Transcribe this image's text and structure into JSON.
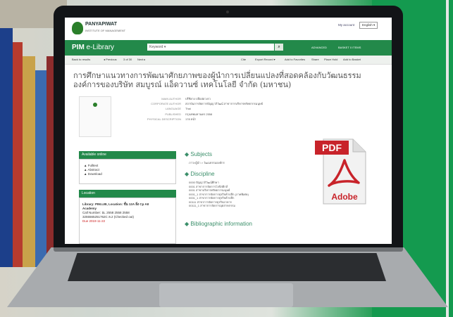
{
  "header": {
    "brand": "PANYAPIWAT",
    "brand_sub": "INSTITUTE OF MANAGEMENT",
    "myaccount": "My account",
    "language": "English ▾"
  },
  "nav": {
    "title_bold": "PIM",
    "title_rest": " e-Library",
    "keyword": "Keyword  ▾",
    "advanced": "ADVANCED",
    "basket": "BASKET 0 ITEMS"
  },
  "toolbar": {
    "back": "Back to results",
    "previous": "◂ Previous",
    "count": "3 of 30",
    "next": "Next ▸",
    "cite": "Cite",
    "export": "Export Record ▾",
    "favorites": "Add to Favorites",
    "share": "Share",
    "hold": "Place Hold",
    "basket": "Add to Basket"
  },
  "record": {
    "title": "การศึกษาแนวทางการพัฒนาศักยภาพของผู้นำการเปลี่ยนแปลงที่สอดคล้องกับวัฒนธรรมองค์การของบริษัท สมบูรณ์ แอ็ดวานซ์ เทคโนโลยี จำกัด (มหาชน)",
    "fields": [
      {
        "k": "MAIN AUTHOR",
        "v": "ปรีชิยาง ปลีอฮ่ฮวงรว"
      },
      {
        "k": "CORPORATE AUTHOR",
        "v": "สถาบันการจัดการปัญญาภิวัฒน์ สาขาการบริหารทรัพยากรมนุษย์"
      },
      {
        "k": "LANGUAGE",
        "v": "Thai"
      },
      {
        "k": "PUBLISHED",
        "v": "กรุงเทพมหานคร 2558"
      },
      {
        "k": "PHYSICAL DESCRIPTION",
        "v": "178 หน้า"
      }
    ]
  },
  "online": {
    "header": "Available online",
    "links": [
      "Fulltext",
      "Abstract",
      "Download"
    ]
  },
  "location": {
    "header": "Location",
    "lines": [
      "Library: PIM.LIB, Location: ชั้น 12A สิ่ง Cp AII",
      "Academy",
      "Call Number: ณ. 2558 2558 2558",
      "3255565251762C ล.2 (Checked out)",
      "Due 2019-11-22"
    ]
  },
  "subjects": {
    "header": "Subjects",
    "items": [
      "ภาวะผู้นำ  > วัฒนธรรมองค์กร"
    ]
  },
  "discipline": {
    "header": "Discipline",
    "items": [
      "0000 ปัญญาภิวัฒน์ศึกษา",
      "0001 สาขาการจัดการโลจิสติกส์",
      "0001 สาขาบริหารทรัพยากรมนุษย์",
      "0001_1 สาขาการจัดการธุรกิจค้าปลีก (ภาคพิเศษ)",
      "0001_1 สาขาการจัดการธุรกิจค้าปลีก",
      "00111 สาขาการจัดการธุรกิจอาหาร",
      "00111_1 สาขาการจัดการอุตสาหกรรม"
    ]
  },
  "biblio": {
    "header": "Bibliographic information"
  },
  "pdf": {
    "label": "PDF",
    "adobe": "Adobe"
  },
  "colors": {
    "accent": "#23894a",
    "pdf_red": "#d1252a"
  }
}
